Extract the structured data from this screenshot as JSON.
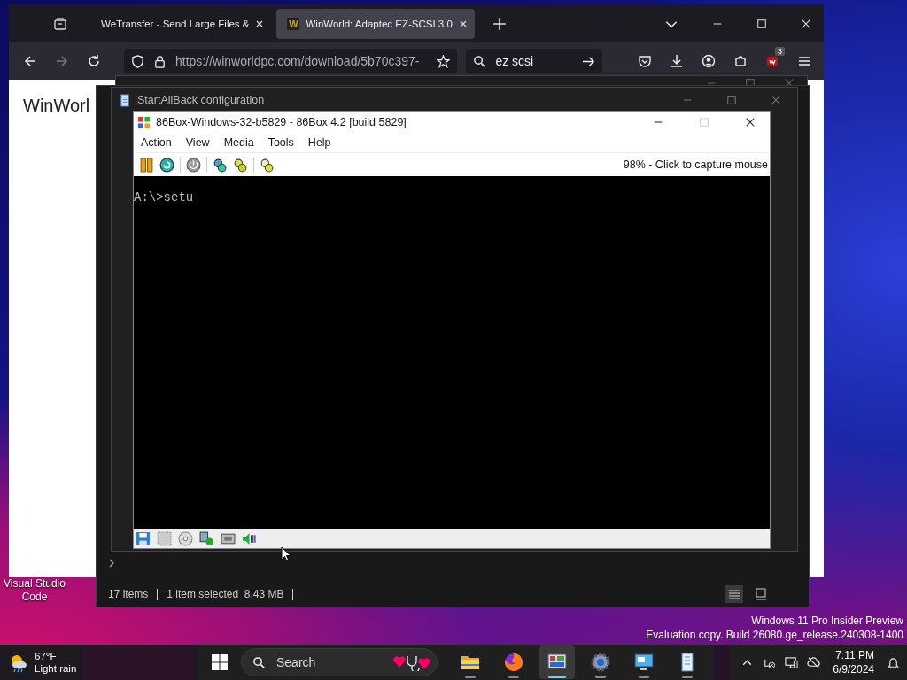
{
  "desktop_icons": [
    {
      "label": "Visual Studio Code"
    }
  ],
  "browser": {
    "tabs": [
      {
        "label": "WeTransfer - Send Large Files &",
        "selected": false
      },
      {
        "label": "WinWorld: Adaptec EZ-SCSI 3.0",
        "selected": true,
        "favicon": "W"
      }
    ],
    "url": "https://winworldpc.com/download/5b70c397-",
    "search_text": "ez scsi",
    "extension_badge": "3",
    "page_heading": "WinWorl"
  },
  "explorer": {
    "status": [
      "17 items",
      "1 item selected  8.43 MB"
    ]
  },
  "startallback": {
    "title": "StartAllBack configuration"
  },
  "emulator": {
    "title": "86Box-Windows-32-b5829 - 86Box 4.2 [build 5829]",
    "menu": [
      "Action",
      "View",
      "Media",
      "Tools",
      "Help"
    ],
    "status": "98% - Click to capture mouse",
    "screen_text": "A:\\>setu"
  },
  "os_notice": [
    "Windows 11 Pro Insider Preview",
    "Evaluation copy. Build 26080.ge_release.240308-1400"
  ],
  "taskbar": {
    "weather": {
      "temperature": "67°F",
      "condition": "Light rain"
    },
    "search_placeholder": "Search",
    "apps": [
      {
        "kind": "folder",
        "selected": false
      },
      {
        "kind": "browser",
        "selected": false
      },
      {
        "kind": "emulator",
        "selected": true
      },
      {
        "kind": "gear",
        "selected": false
      },
      {
        "kind": "monitor",
        "selected": false
      },
      {
        "kind": "book",
        "selected": false
      }
    ],
    "time": "7:11 PM",
    "date": "6/9/2024"
  }
}
